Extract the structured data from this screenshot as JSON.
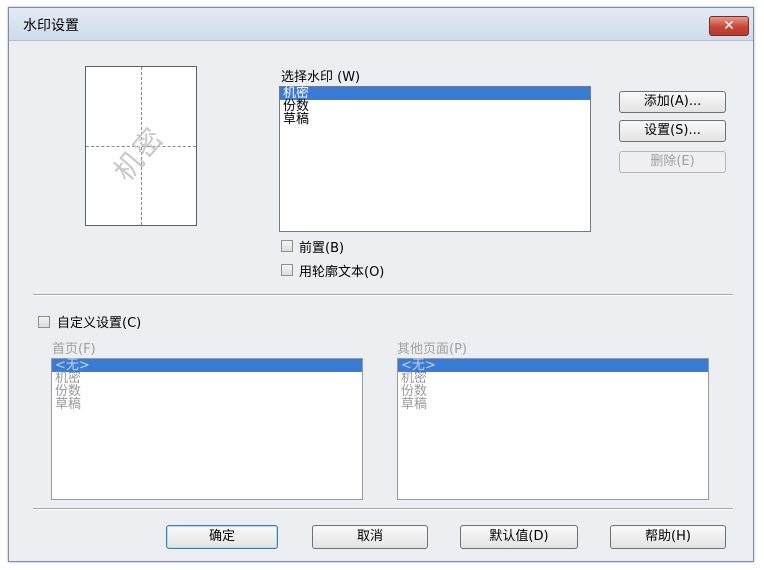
{
  "window": {
    "title": "水印设置",
    "close_symbol": "✕"
  },
  "watermark": {
    "preview_text": "机密",
    "select_label": "选择水印 (W)",
    "items": [
      "机密",
      "份数",
      "草稿"
    ],
    "selected": "机密",
    "add_label": "添加(A)...",
    "settings_label": "设置(S)...",
    "delete_label": "删除(E)",
    "front_label": "前置(B)",
    "outline_label": "用轮廓文本(O)"
  },
  "custom": {
    "label": "自定义设置(C)",
    "first_page": {
      "label": "首页(F)",
      "items": [
        "<无>",
        "机密",
        "份数",
        "草稿"
      ],
      "selected": "<无>"
    },
    "other_pages": {
      "label": "其他页面(P)",
      "items": [
        "<无>",
        "机密",
        "份数",
        "草稿"
      ],
      "selected": "<无>"
    }
  },
  "footer": {
    "ok_label": "确定",
    "cancel_label": "取消",
    "default_label": "默认值(D)",
    "help_label": "帮助(H)"
  }
}
